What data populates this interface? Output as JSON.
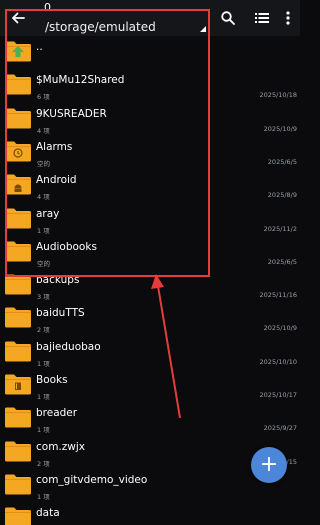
{
  "toolbar": {
    "top_label": "0",
    "path": "/storage/emulated",
    "icons": [
      "back-arrow-icon",
      "search-icon",
      "list-view-icon",
      "more-vertical-icon"
    ]
  },
  "files": [
    {
      "name": "..",
      "sub": "",
      "date": "",
      "icon": "folder-up-icon"
    },
    {
      "name": "$MuMu12Shared",
      "sub": "6 项",
      "date": "2025/10/18",
      "icon": "folder-icon"
    },
    {
      "name": "9KUSREADER",
      "sub": "4 项",
      "date": "2025/10/9",
      "icon": "folder-icon"
    },
    {
      "name": "Alarms",
      "sub": "空的",
      "date": "2025/6/5",
      "icon": "alarm-folder-icon"
    },
    {
      "name": "Android",
      "sub": "4 项",
      "date": "2025/8/9",
      "icon": "android-folder-icon"
    },
    {
      "name": "aray",
      "sub": "1 项",
      "date": "2025/11/2",
      "icon": "folder-icon"
    },
    {
      "name": "Audiobooks",
      "sub": "空的",
      "date": "2025/6/5",
      "icon": "folder-icon"
    },
    {
      "name": "backups",
      "sub": "3 项",
      "date": "2025/11/16",
      "icon": "folder-icon"
    },
    {
      "name": "baiduTTS",
      "sub": "2 项",
      "date": "2025/10/9",
      "icon": "folder-icon"
    },
    {
      "name": "bajieduobao",
      "sub": "1 项",
      "date": "2025/10/10",
      "icon": "folder-icon"
    },
    {
      "name": "Books",
      "sub": "1 项",
      "date": "2025/10/17",
      "icon": "book-folder-icon"
    },
    {
      "name": "breader",
      "sub": "1 项",
      "date": "2025/9/27",
      "icon": "folder-icon"
    },
    {
      "name": "com.zwjx",
      "sub": "2 项",
      "date": "2025/10/15",
      "icon": "folder-icon"
    },
    {
      "name": "com_gitvdemo_video",
      "sub": "1 项",
      "date": "",
      "icon": "folder-icon"
    },
    {
      "name": "data",
      "sub": "1 项",
      "date": "",
      "icon": "folder-icon"
    }
  ],
  "fab": {
    "label": "+"
  },
  "colors": {
    "background": "#0b0b0d",
    "toolbar": "#15161a",
    "folder": "#f5a623",
    "annotation": "#e53b3b",
    "fab": "#4b86d9",
    "up_arrow": "#4caf50"
  }
}
